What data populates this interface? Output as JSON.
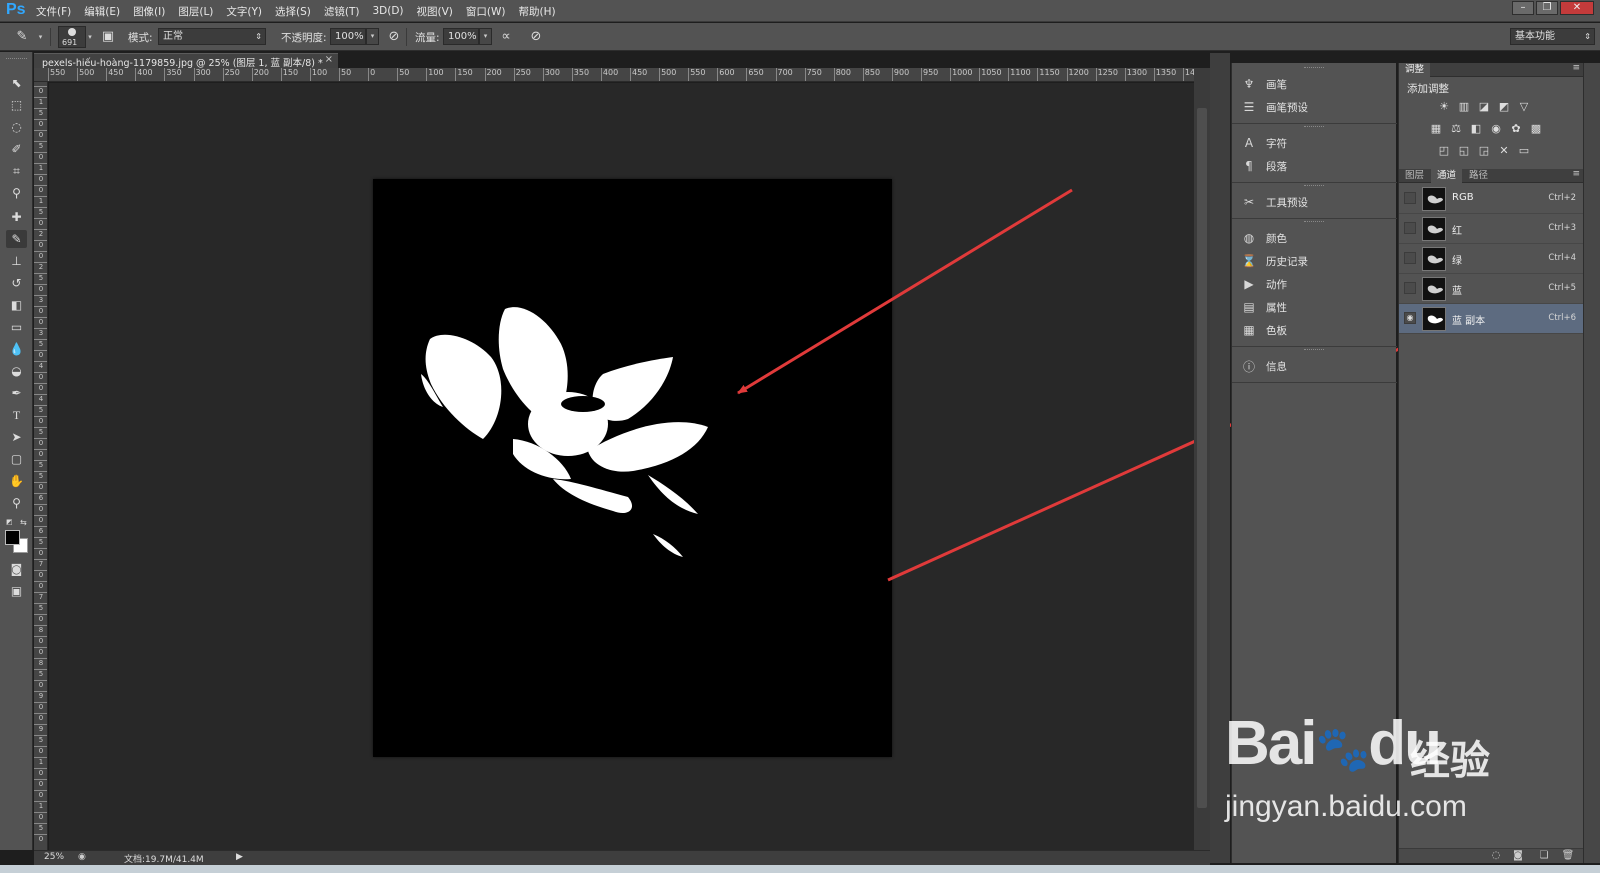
{
  "app": {
    "logo": "Ps",
    "menu": [
      "文件(F)",
      "编辑(E)",
      "图像(I)",
      "图层(L)",
      "文字(Y)",
      "选择(S)",
      "滤镜(T)",
      "3D(D)",
      "视图(V)",
      "窗口(W)",
      "帮助(H)"
    ],
    "window_controls": [
      "–",
      "❐",
      "✕"
    ],
    "workspace": "基本功能"
  },
  "options": {
    "brush_size": "691",
    "mode_label": "模式:",
    "mode_value": "正常",
    "opacity_label": "不透明度:",
    "opacity_value": "100%",
    "flow_label": "流量:",
    "flow_value": "100%"
  },
  "document": {
    "tab_title": "pexels-hiếu-hoàng-1179859.jpg @ 25% (图层 1, 蓝 副本/8) *",
    "close": "×",
    "zoom": "25%",
    "doc_size": "文档:19.7M/41.4M"
  },
  "ruler": {
    "h_ticks": [
      "550",
      "500",
      "450",
      "400",
      "350",
      "300",
      "250",
      "200",
      "150",
      "100",
      "50",
      "0",
      "50",
      "100",
      "150",
      "200",
      "250",
      "300",
      "350",
      "400",
      "450",
      "500",
      "550",
      "600",
      "650",
      "700",
      "750",
      "800",
      "850",
      "900",
      "950",
      "1000",
      "1050",
      "1100",
      "1150",
      "1200",
      "1250",
      "1300",
      "1350",
      "1400"
    ],
    "v_ticks": [
      "0",
      "1",
      "5",
      "0",
      "0",
      "5",
      "0",
      "1",
      "0",
      "0",
      "1",
      "5",
      "0",
      "2",
      "0",
      "0",
      "2",
      "5",
      "0",
      "3",
      "0",
      "0",
      "3",
      "5",
      "0",
      "4",
      "0",
      "0",
      "4",
      "5",
      "0",
      "5",
      "0",
      "0",
      "5",
      "5",
      "0",
      "6",
      "0",
      "0",
      "6",
      "5",
      "0",
      "7",
      "0",
      "0",
      "7",
      "5",
      "0",
      "8",
      "0",
      "0",
      "8",
      "5",
      "0",
      "9",
      "0",
      "0",
      "9",
      "5",
      "0",
      "1",
      "0",
      "0",
      "0",
      "1",
      "0",
      "5",
      "0"
    ]
  },
  "mid_panel": {
    "groups": [
      [
        {
          "icon": "brush-icon",
          "glyph": "♆",
          "label": "画笔"
        },
        {
          "icon": "brush-presets-icon",
          "glyph": "☰",
          "label": "画笔预设"
        }
      ],
      [
        {
          "icon": "character-icon",
          "glyph": "A",
          "label": "字符"
        },
        {
          "icon": "paragraph-icon",
          "glyph": "¶",
          "label": "段落"
        }
      ],
      [
        {
          "icon": "tool-presets-icon",
          "glyph": "✂",
          "label": "工具预设"
        }
      ],
      [
        {
          "icon": "color-icon",
          "glyph": "◍",
          "label": "颜色"
        },
        {
          "icon": "history-icon",
          "glyph": "⌛",
          "label": "历史记录"
        },
        {
          "icon": "actions-icon",
          "glyph": "▶",
          "label": "动作"
        },
        {
          "icon": "properties-icon",
          "glyph": "▤",
          "label": "属性"
        },
        {
          "icon": "swatches-icon",
          "glyph": "▦",
          "label": "色板"
        }
      ],
      [
        {
          "icon": "info-icon",
          "glyph": "ⓘ",
          "label": "信息"
        }
      ]
    ]
  },
  "adjustments": {
    "tab": "调整",
    "subtitle": "添加调整",
    "row1": [
      "☀",
      "▥",
      "◪",
      "◩",
      "▽"
    ],
    "row2": [
      "▦",
      "⚖",
      "◧",
      "◉",
      "✿",
      "▩"
    ],
    "row3": [
      "◰",
      "◱",
      "◲",
      "✕",
      "▭"
    ]
  },
  "layers_panel": {
    "tabs": [
      "图层",
      "通道",
      "路径"
    ],
    "active_tab": "通道",
    "channels": [
      {
        "name": "RGB",
        "key": "Ctrl+2",
        "visible": false,
        "selected": false
      },
      {
        "name": "红",
        "key": "Ctrl+3",
        "visible": false,
        "selected": false
      },
      {
        "name": "绿",
        "key": "Ctrl+4",
        "visible": false,
        "selected": false
      },
      {
        "name": "蓝",
        "key": "Ctrl+5",
        "visible": false,
        "selected": false
      },
      {
        "name": "蓝 副本",
        "key": "Ctrl+6",
        "visible": true,
        "selected": true
      }
    ]
  },
  "watermark": {
    "brand": "Bai",
    "paw": "du",
    "product": "经验",
    "url": "jingyan.baidu.com"
  },
  "colors": {
    "accent": "#31a8ff",
    "annotation_arrow": "#e03a3a",
    "selected_row": "#5d6b80"
  }
}
